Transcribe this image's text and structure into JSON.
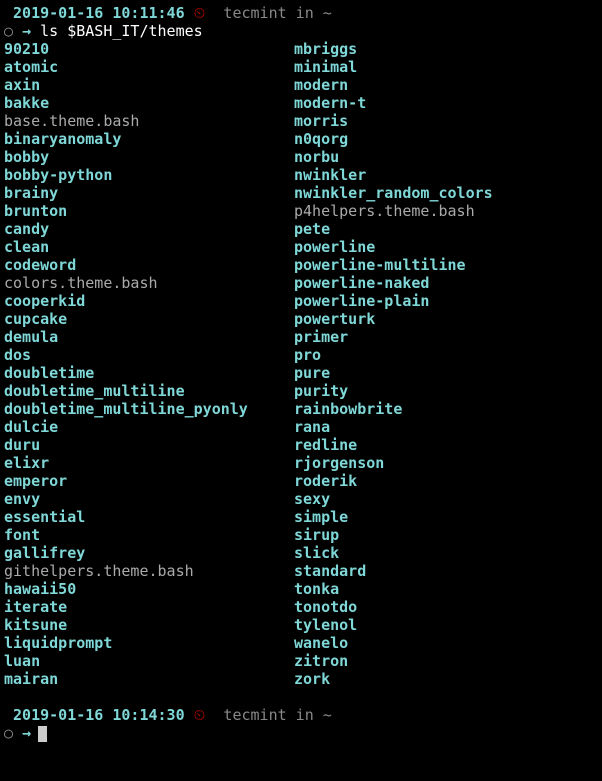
{
  "prompt1": {
    "timestamp": "2019-01-16 10:11:46",
    "clock": "⏲",
    "user": "tecmint",
    "in": "in",
    "path": "~",
    "circ": "○",
    "arrow": "→",
    "command": "ls $BASH_IT/themes"
  },
  "listing": {
    "col1": [
      {
        "name": "90210",
        "type": "dir"
      },
      {
        "name": "atomic",
        "type": "dir"
      },
      {
        "name": "axin",
        "type": "dir"
      },
      {
        "name": "bakke",
        "type": "dir"
      },
      {
        "name": "base.theme.bash",
        "type": "file"
      },
      {
        "name": "binaryanomaly",
        "type": "dir"
      },
      {
        "name": "bobby",
        "type": "dir"
      },
      {
        "name": "bobby-python",
        "type": "dir"
      },
      {
        "name": "brainy",
        "type": "dir"
      },
      {
        "name": "brunton",
        "type": "dir"
      },
      {
        "name": "candy",
        "type": "dir"
      },
      {
        "name": "clean",
        "type": "dir"
      },
      {
        "name": "codeword",
        "type": "dir"
      },
      {
        "name": "colors.theme.bash",
        "type": "file"
      },
      {
        "name": "cooperkid",
        "type": "dir"
      },
      {
        "name": "cupcake",
        "type": "dir"
      },
      {
        "name": "demula",
        "type": "dir"
      },
      {
        "name": "dos",
        "type": "dir"
      },
      {
        "name": "doubletime",
        "type": "dir"
      },
      {
        "name": "doubletime_multiline",
        "type": "dir"
      },
      {
        "name": "doubletime_multiline_pyonly",
        "type": "dir"
      },
      {
        "name": "dulcie",
        "type": "dir"
      },
      {
        "name": "duru",
        "type": "dir"
      },
      {
        "name": "elixr",
        "type": "dir"
      },
      {
        "name": "emperor",
        "type": "dir"
      },
      {
        "name": "envy",
        "type": "dir"
      },
      {
        "name": "essential",
        "type": "dir"
      },
      {
        "name": "font",
        "type": "dir"
      },
      {
        "name": "gallifrey",
        "type": "dir"
      },
      {
        "name": "githelpers.theme.bash",
        "type": "file"
      },
      {
        "name": "hawaii50",
        "type": "dir"
      },
      {
        "name": "iterate",
        "type": "dir"
      },
      {
        "name": "kitsune",
        "type": "dir"
      },
      {
        "name": "liquidprompt",
        "type": "dir"
      },
      {
        "name": "luan",
        "type": "dir"
      },
      {
        "name": "mairan",
        "type": "dir"
      }
    ],
    "col2": [
      {
        "name": "mbriggs",
        "type": "dir"
      },
      {
        "name": "minimal",
        "type": "dir"
      },
      {
        "name": "modern",
        "type": "dir"
      },
      {
        "name": "modern-t",
        "type": "dir"
      },
      {
        "name": "morris",
        "type": "dir"
      },
      {
        "name": "n0qorg",
        "type": "dir"
      },
      {
        "name": "norbu",
        "type": "dir"
      },
      {
        "name": "nwinkler",
        "type": "dir"
      },
      {
        "name": "nwinkler_random_colors",
        "type": "dir"
      },
      {
        "name": "p4helpers.theme.bash",
        "type": "file"
      },
      {
        "name": "pete",
        "type": "dir"
      },
      {
        "name": "powerline",
        "type": "dir"
      },
      {
        "name": "powerline-multiline",
        "type": "dir"
      },
      {
        "name": "powerline-naked",
        "type": "dir"
      },
      {
        "name": "powerline-plain",
        "type": "dir"
      },
      {
        "name": "powerturk",
        "type": "dir"
      },
      {
        "name": "primer",
        "type": "dir"
      },
      {
        "name": "pro",
        "type": "dir"
      },
      {
        "name": "pure",
        "type": "dir"
      },
      {
        "name": "purity",
        "type": "dir"
      },
      {
        "name": "rainbowbrite",
        "type": "dir"
      },
      {
        "name": "rana",
        "type": "dir"
      },
      {
        "name": "redline",
        "type": "dir"
      },
      {
        "name": "rjorgenson",
        "type": "dir"
      },
      {
        "name": "roderik",
        "type": "dir"
      },
      {
        "name": "sexy",
        "type": "dir"
      },
      {
        "name": "simple",
        "type": "dir"
      },
      {
        "name": "sirup",
        "type": "dir"
      },
      {
        "name": "slick",
        "type": "dir"
      },
      {
        "name": "standard",
        "type": "dir"
      },
      {
        "name": "tonka",
        "type": "dir"
      },
      {
        "name": "tonotdo",
        "type": "dir"
      },
      {
        "name": "tylenol",
        "type": "dir"
      },
      {
        "name": "wanelo",
        "type": "dir"
      },
      {
        "name": "zitron",
        "type": "dir"
      },
      {
        "name": "zork",
        "type": "dir"
      }
    ]
  },
  "prompt2": {
    "timestamp": "2019-01-16 10:14:30",
    "clock": "⏲",
    "user": "tecmint",
    "in": "in",
    "path": "~",
    "circ": "○",
    "arrow": "→"
  }
}
